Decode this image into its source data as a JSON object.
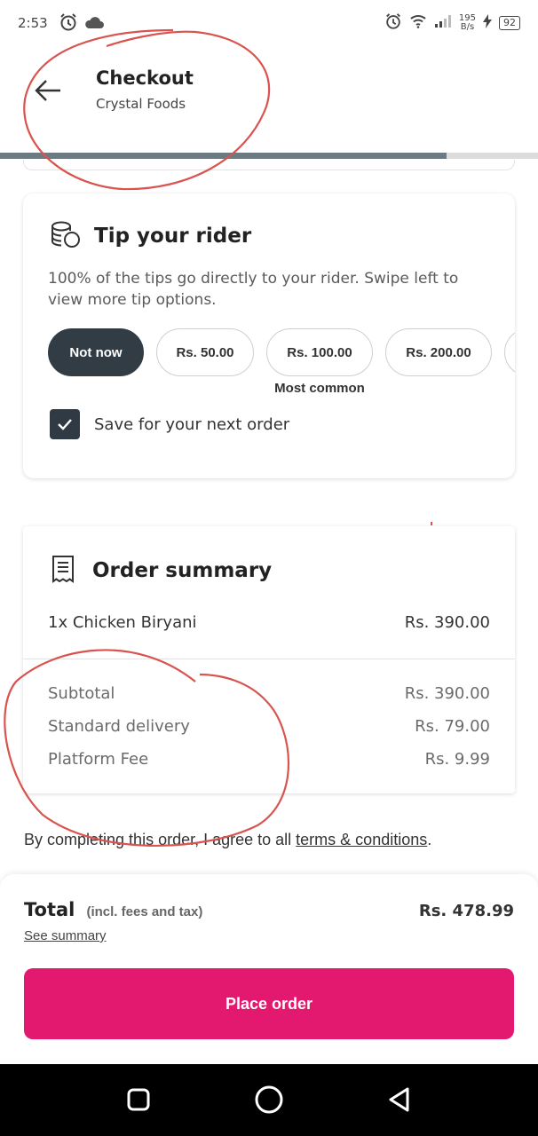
{
  "status_bar": {
    "time": "2:53",
    "net_speed_value": "195",
    "net_speed_unit": "B/s",
    "battery": "92"
  },
  "header": {
    "title": "Checkout",
    "subtitle": "Crystal Foods",
    "progress": 0.83
  },
  "tip": {
    "title": "Tip your rider",
    "description": "100% of the tips go directly to your rider. Swipe left to view more tip options.",
    "options": [
      {
        "label": "Not now",
        "selected": true
      },
      {
        "label": "Rs. 50.00"
      },
      {
        "label": "Rs. 100.00",
        "badge": "Most common"
      },
      {
        "label": "Rs. 200.00"
      }
    ],
    "save_label": "Save for your next order",
    "save_checked": true
  },
  "summary": {
    "title": "Order summary",
    "items": [
      {
        "label": "1x Chicken Biryani",
        "amount": "Rs. 390.00"
      }
    ],
    "fees": [
      {
        "label": "Subtotal",
        "amount": "Rs. 390.00"
      },
      {
        "label": "Standard delivery",
        "amount": "Rs. 79.00"
      },
      {
        "label": "Platform Fee",
        "amount": "Rs. 9.99"
      }
    ]
  },
  "terms": {
    "prefix": "By completing this order, I agree to all ",
    "link": "terms & conditions",
    "suffix": "."
  },
  "checkout": {
    "total_label": "Total",
    "total_note": "(incl. fees and tax)",
    "total_amount": "Rs. 478.99",
    "see_summary": "See summary",
    "place_order": "Place order",
    "accent": "#e2196f"
  }
}
